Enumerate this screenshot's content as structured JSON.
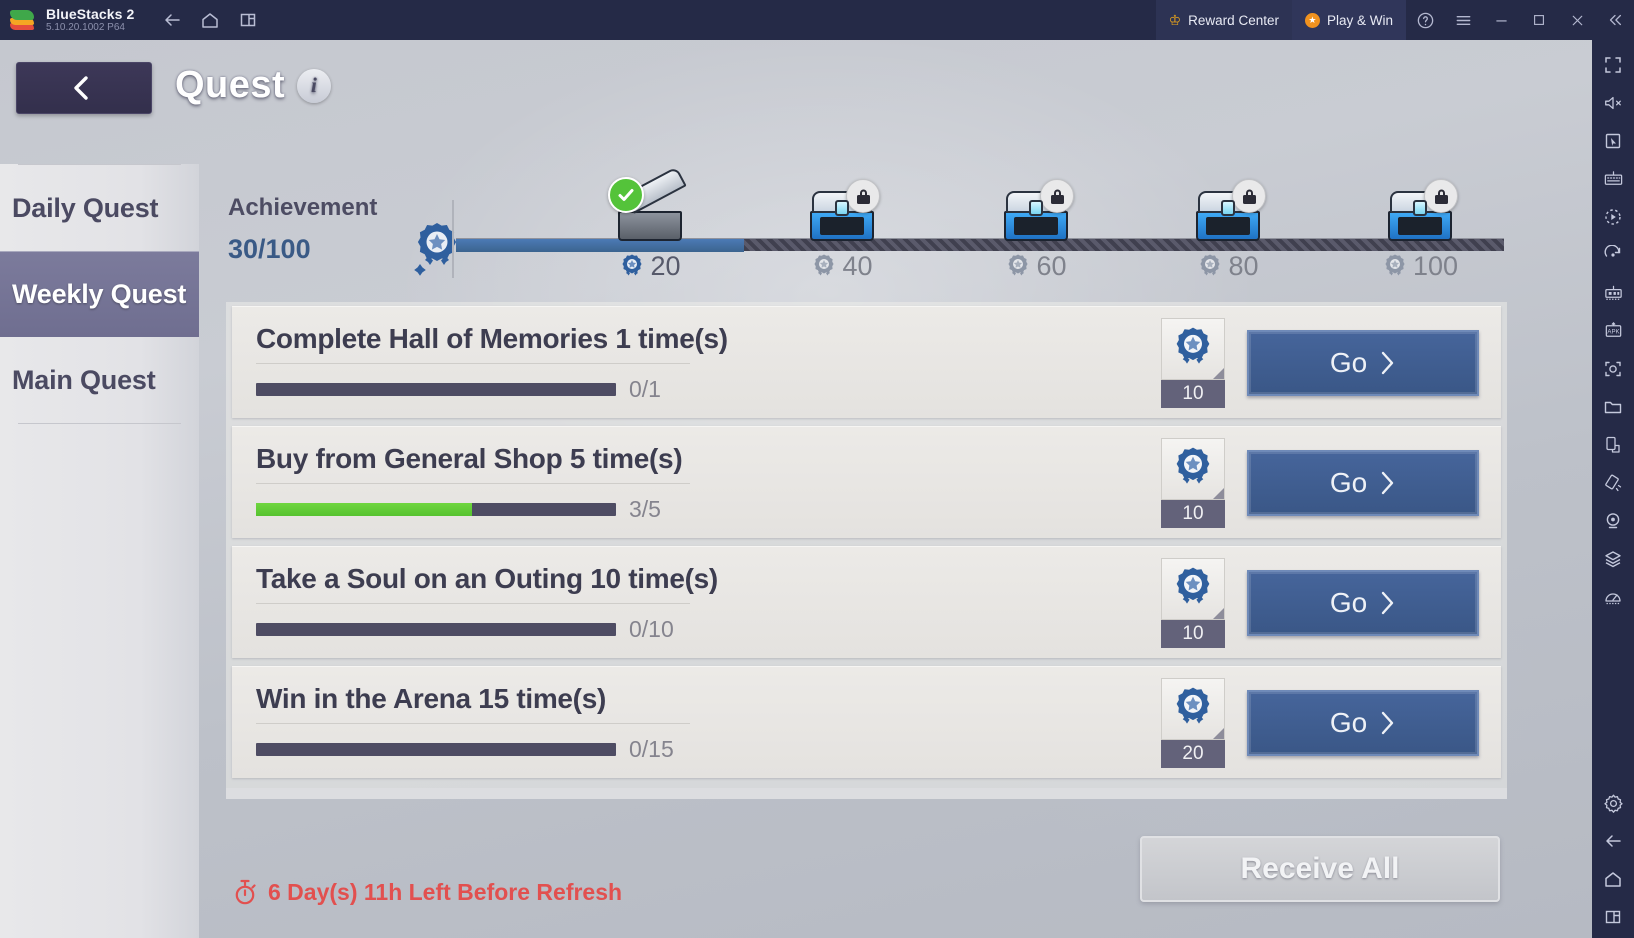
{
  "titlebar": {
    "app_name": "BlueStacks 2",
    "version": "5.10.20.1002  P64",
    "reward_center": "Reward Center",
    "play_and_win": "Play & Win",
    "nav_icons": [
      "back-arrow-icon",
      "home-icon",
      "multi-instance-icon"
    ],
    "window_controls": [
      "help-icon",
      "menu-icon",
      "minimize-icon",
      "maximize-icon",
      "close-icon",
      "collapse-icon"
    ]
  },
  "header": {
    "title": "Quest",
    "info_icon": "info-icon",
    "back_icon": "chevron-left-icon"
  },
  "sidebar": {
    "items": [
      {
        "label": "Daily Quest",
        "active": false
      },
      {
        "label": "Weekly Quest",
        "active": true
      },
      {
        "label": "Main Quest",
        "active": false
      }
    ]
  },
  "achievement": {
    "label": "Achievement",
    "count": "30/100",
    "current": 30,
    "max": 100,
    "medal_icon": "achievement-medal-icon",
    "milestones": [
      {
        "value": "20",
        "state": "claimed",
        "icon": "open-chest-icon",
        "badge": "check-badge"
      },
      {
        "value": "40",
        "state": "locked",
        "icon": "blue-chest-icon",
        "badge": "lock-badge"
      },
      {
        "value": "60",
        "state": "locked",
        "icon": "blue-chest-icon",
        "badge": "lock-badge"
      },
      {
        "value": "80",
        "state": "locked",
        "icon": "blue-chest-icon",
        "badge": "lock-badge"
      },
      {
        "value": "100",
        "state": "locked",
        "icon": "blue-chest-icon",
        "badge": "lock-badge"
      }
    ]
  },
  "quests": [
    {
      "title": "Complete Hall of Memories 1 time(s)",
      "progress_text": "0/1",
      "progress_pct": 0,
      "reward_count": "10",
      "reward_icon": "achievement-medal-icon",
      "action_label": "Go"
    },
    {
      "title": "Buy from General Shop 5 time(s)",
      "progress_text": "3/5",
      "progress_pct": 60,
      "reward_count": "10",
      "reward_icon": "achievement-medal-icon",
      "action_label": "Go"
    },
    {
      "title": "Take a Soul on an Outing 10 time(s)",
      "progress_text": "0/10",
      "progress_pct": 0,
      "reward_count": "10",
      "reward_icon": "achievement-medal-icon",
      "action_label": "Go"
    },
    {
      "title": "Win in the Arena 15 time(s)",
      "progress_text": "0/15",
      "progress_pct": 0,
      "reward_count": "20",
      "reward_icon": "achievement-medal-icon",
      "action_label": "Go"
    }
  ],
  "footer": {
    "refresh_text": "6 Day(s) 11h Left Before Refresh",
    "refresh_icon": "stopwatch-icon",
    "receive_all": "Receive All"
  },
  "right_toolbar": {
    "icons": [
      "fullscreen-icon",
      "mute-icon",
      "cursor-icon",
      "keyboard-icon",
      "macro-play-icon",
      "rotate-icon",
      "multi-instance-manager-icon",
      "apk-install-icon",
      "screenshot-icon",
      "media-folder-icon",
      "sync-operations-icon",
      "shake-icon",
      "location-icon",
      "layers-icon",
      "performance-icon",
      "settings-icon",
      "android-back-icon",
      "android-home-icon",
      "android-recents-icon"
    ]
  },
  "colors": {
    "titlebar_bg": "#252a47",
    "accent_blue": "#3a5a86",
    "button_blue": "#46659b",
    "progress_green": "#56c22f",
    "refresh_red": "#e2504f",
    "nav_active": "#6f6e90"
  }
}
